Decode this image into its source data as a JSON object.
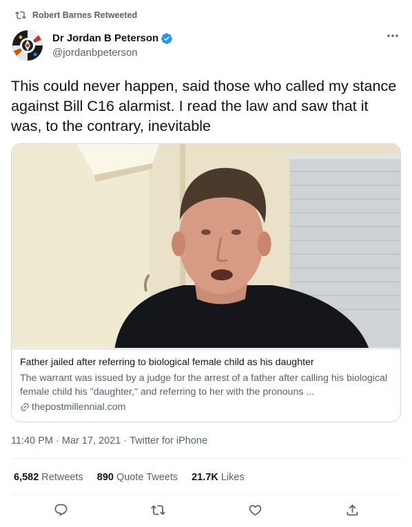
{
  "retweet": {
    "label": "Robert Barnes Retweeted",
    "icon": "retweet-icon"
  },
  "author": {
    "name": "Dr Jordan B Peterson",
    "handle": "@jordanbpeterson",
    "verified": true,
    "verified_color": "#1d9bf0"
  },
  "tweet": {
    "text": "This could never happen, said those who called my stance against Bill C16 alarmist. I read the law and saw that it was, to the contrary, inevitable"
  },
  "card": {
    "title": "Father jailed after referring to biological female child as his daughter",
    "description": "The warrant was issued by a judge for the arrest of a father after calling his biological female child his \"daughter,\" and referring to her with the pronouns ...",
    "domain": "thepostmillennial.com"
  },
  "meta": {
    "time": "11:40 PM",
    "separator1": " · ",
    "date": "Mar 17, 2021",
    "separator2": " · ",
    "source": "Twitter for iPhone"
  },
  "stats": {
    "retweets_count": "6,582",
    "retweets_label": "Retweets",
    "quotes_count": "890",
    "quotes_label": "Quote Tweets",
    "likes_count": "21.7K",
    "likes_label": "Likes"
  },
  "actions": {
    "reply_icon": "reply-icon",
    "retweet_icon": "retweet-icon",
    "like_icon": "heart-icon",
    "share_icon": "share-icon"
  },
  "colors": {
    "text_primary": "#0f1419",
    "text_secondary": "#536471",
    "border": "#cfd9de",
    "accent": "#1d9bf0"
  }
}
